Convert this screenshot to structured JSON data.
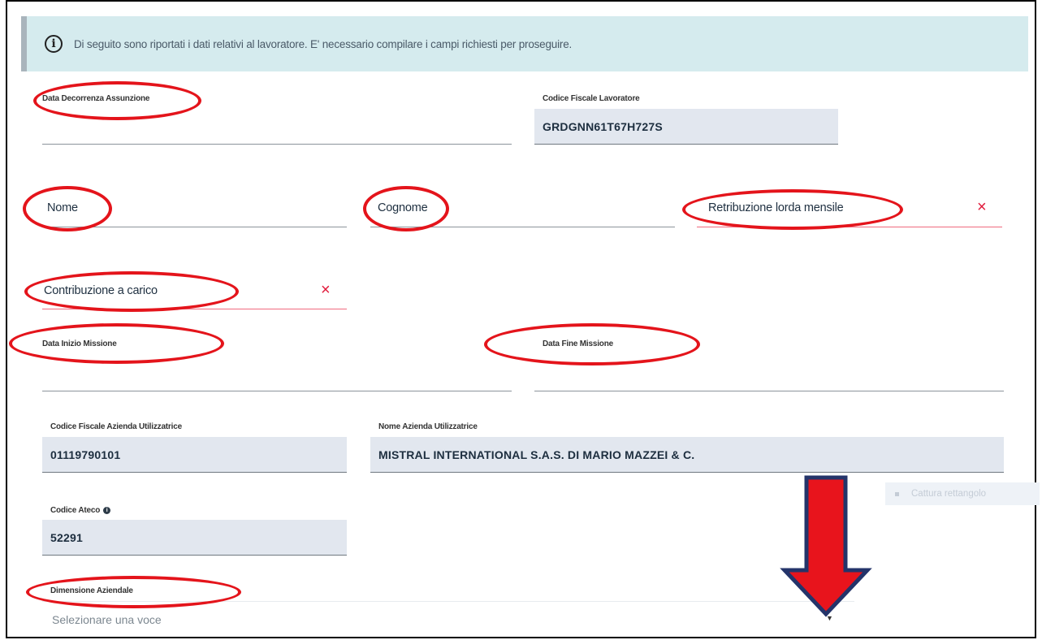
{
  "banner": {
    "icon": "info-circle-icon",
    "text": "Di seguito sono riportati i dati relativi al lavoratore. E' necessario compilare i campi richiesti per proseguire."
  },
  "fields": {
    "data_decorrenza": {
      "label": "Data Decorrenza Assunzione",
      "value": ""
    },
    "codice_fiscale_lavoratore": {
      "label": "Codice Fiscale Lavoratore",
      "value": "GRDGNN61T67H727S"
    },
    "nome": {
      "label": "Nome",
      "value": ""
    },
    "cognome": {
      "label": "Cognome",
      "value": ""
    },
    "retribuzione": {
      "label": "Retribuzione lorda mensile",
      "value": "",
      "clear": "×"
    },
    "contribuzione": {
      "label": "Contribuzione a carico",
      "value": "",
      "clear": "×"
    },
    "data_inizio_missione": {
      "label": "Data Inizio Missione",
      "value": ""
    },
    "data_fine_missione": {
      "label": "Data Fine Missione",
      "value": ""
    },
    "cf_azienda": {
      "label": "Codice Fiscale Azienda Utilizzatrice",
      "value": "01119790101"
    },
    "nome_azienda": {
      "label": "Nome Azienda Utilizzatrice",
      "value": "MISTRAL INTERNATIONAL S.A.S. DI MARIO MAZZEI & C."
    },
    "codice_ateco": {
      "label": "Codice Ateco",
      "info_icon": "i",
      "value": "52291"
    },
    "dimensione_aziendale": {
      "label": "Dimensione Aziendale",
      "placeholder": "Selezionare una voce",
      "caret": "▼"
    }
  },
  "capture_button": {
    "label": "Cattura rettangolo"
  },
  "colors": {
    "annotation_red": "#e4141b",
    "error_pink": "#f06a7e",
    "banner_bg": "#d5ebee",
    "readonly_bg": "#e2e7ef"
  }
}
